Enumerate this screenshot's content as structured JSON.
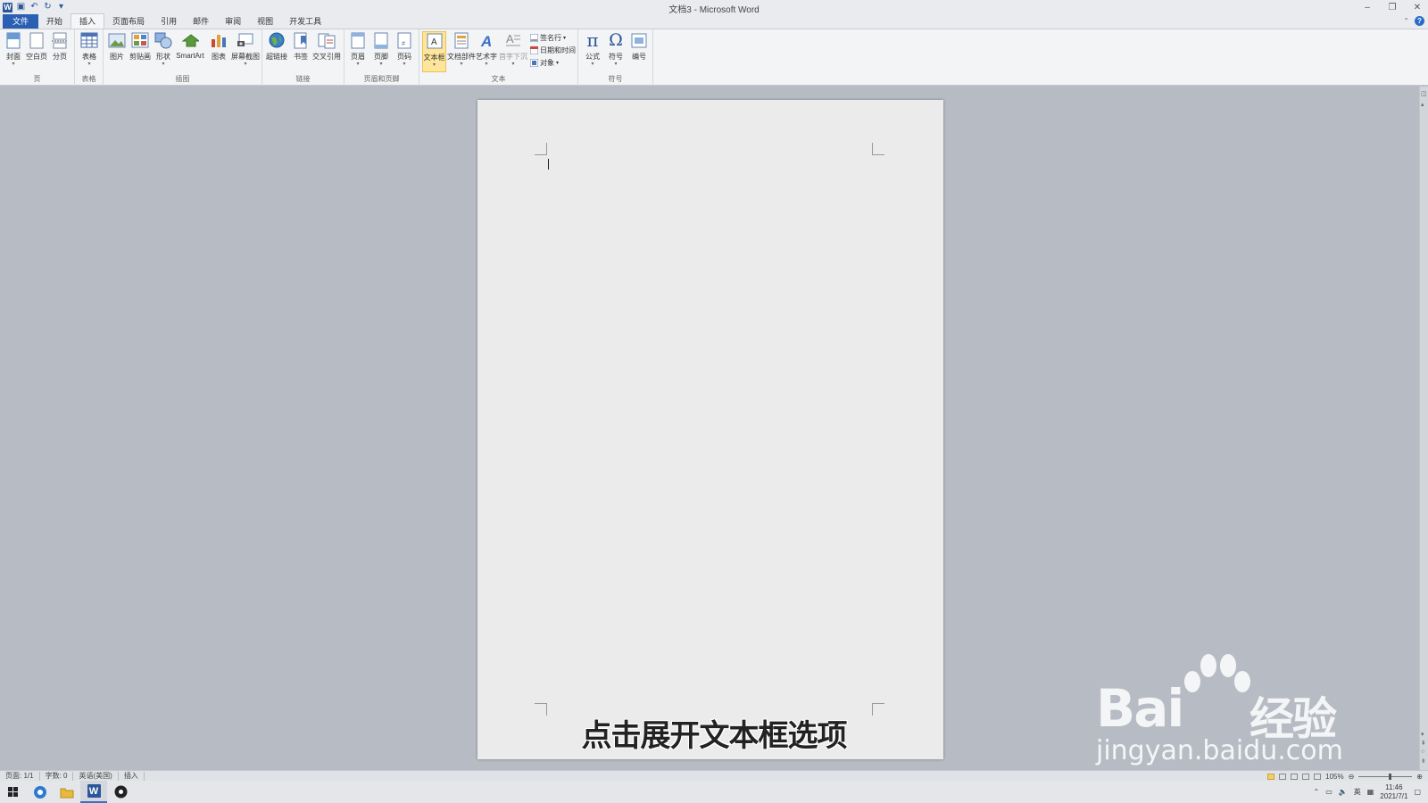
{
  "window": {
    "title": "文档3 - Microsoft Word",
    "controls": [
      "–",
      "❐",
      "✕"
    ]
  },
  "tabs": [
    {
      "label": "文件"
    },
    {
      "label": "开始"
    },
    {
      "label": "插入"
    },
    {
      "label": "页面布局"
    },
    {
      "label": "引用"
    },
    {
      "label": "邮件"
    },
    {
      "label": "审阅"
    },
    {
      "label": "视图"
    },
    {
      "label": "开发工具"
    }
  ],
  "active_tab": "插入",
  "ribbon": {
    "groups": {
      "pages": "页",
      "tables": "表格",
      "illustrations": "插图",
      "links": "链接",
      "header_footer": "页眉和页脚",
      "text": "文本",
      "symbols": "符号"
    },
    "buttons": {
      "cover": "封面",
      "blank": "空白页",
      "pagebreak": "分页",
      "table": "表格",
      "picture": "图片",
      "clipart": "剪贴画",
      "shapes": "形状",
      "smartart": "SmartArt",
      "chart": "图表",
      "screenshot": "屏幕截图",
      "hyperlink": "超链接",
      "bookmark": "书签",
      "crossref": "交叉引用",
      "header": "页眉",
      "footer": "页脚",
      "pagenumber": "页码",
      "textbox": "文本框",
      "quickparts": "文档部件",
      "wordart": "艺术字",
      "dropcap": "首字下沉",
      "signature": "签名行",
      "datetime": "日期和时间",
      "object": "对象",
      "equation": "公式",
      "symbol": "符号",
      "numbering": "编号"
    }
  },
  "status": {
    "page": "页面: 1/1",
    "words": "字数: 0",
    "language": "英语(美国)",
    "mode": "插入",
    "zoom": "105%"
  },
  "subtitle": "点击展开文本框选项",
  "watermark": {
    "brand": "Bai",
    "brand_cn": "经验",
    "url": "jingyan.baidu.com"
  },
  "taskbar": {
    "ime": "英",
    "time": "11:46",
    "date": "2021/7/1"
  },
  "colors": {
    "accent": "#2b579a",
    "file_tab": "#2b5fb4",
    "highlight": "#fde59a"
  }
}
